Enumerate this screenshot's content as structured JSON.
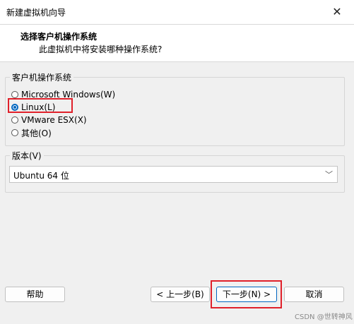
{
  "window": {
    "title": "新建虚拟机向导",
    "close_glyph": "✕"
  },
  "header": {
    "title": "选择客户机操作系统",
    "subtitle": "此虚拟机中将安装哪种操作系统?"
  },
  "guest_os": {
    "legend": "客户机操作系统",
    "options": [
      {
        "label": "Microsoft Windows(W)",
        "selected": false
      },
      {
        "label": "Linux(L)",
        "selected": true
      },
      {
        "label": "VMware ESX(X)",
        "selected": false
      },
      {
        "label": "其他(O)",
        "selected": false
      }
    ]
  },
  "version": {
    "legend": "版本(V)",
    "selected": "Ubuntu 64 位"
  },
  "buttons": {
    "help": "帮助",
    "back": "< 上一步(B)",
    "next": "下一步(N) >",
    "cancel": "取消"
  },
  "watermark": "CSDN @世转神风",
  "colors": {
    "accent": "#0067c0",
    "highlight": "#e0202a"
  }
}
